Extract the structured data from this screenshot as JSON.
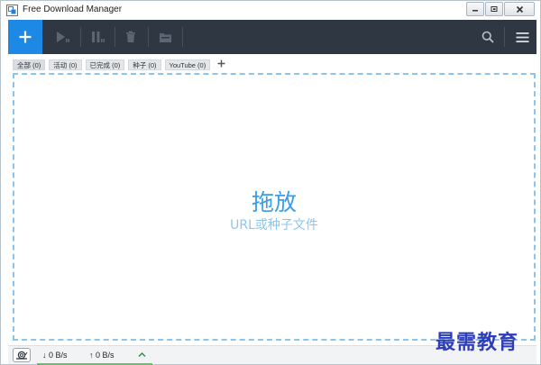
{
  "window": {
    "title": "Free Download Manager"
  },
  "toolbar": {
    "icons": [
      "plus-icon",
      "play-icon",
      "pause-icon",
      "trash-icon",
      "folder-icon",
      "search-icon",
      "menu-icon"
    ]
  },
  "tabs": [
    {
      "label": "全部 (0)"
    },
    {
      "label": "活动 (0)"
    },
    {
      "label": "已完成 (0)"
    },
    {
      "label": "种子 (0)"
    },
    {
      "label": "YouTube (0)"
    }
  ],
  "dropzone": {
    "title": "拖放",
    "subtitle": "URL或种子文件"
  },
  "status": {
    "download_speed": "↓  0 B/s",
    "upload_speed": "↑  0 B/s"
  },
  "watermark": "最需教育",
  "colors": {
    "accent": "#1e88e5",
    "toolbar_bg": "#2f3743",
    "drop_border": "#8cc4ee",
    "drop_text": "#3a9de5",
    "status_bar_accent": "#61c36a"
  }
}
